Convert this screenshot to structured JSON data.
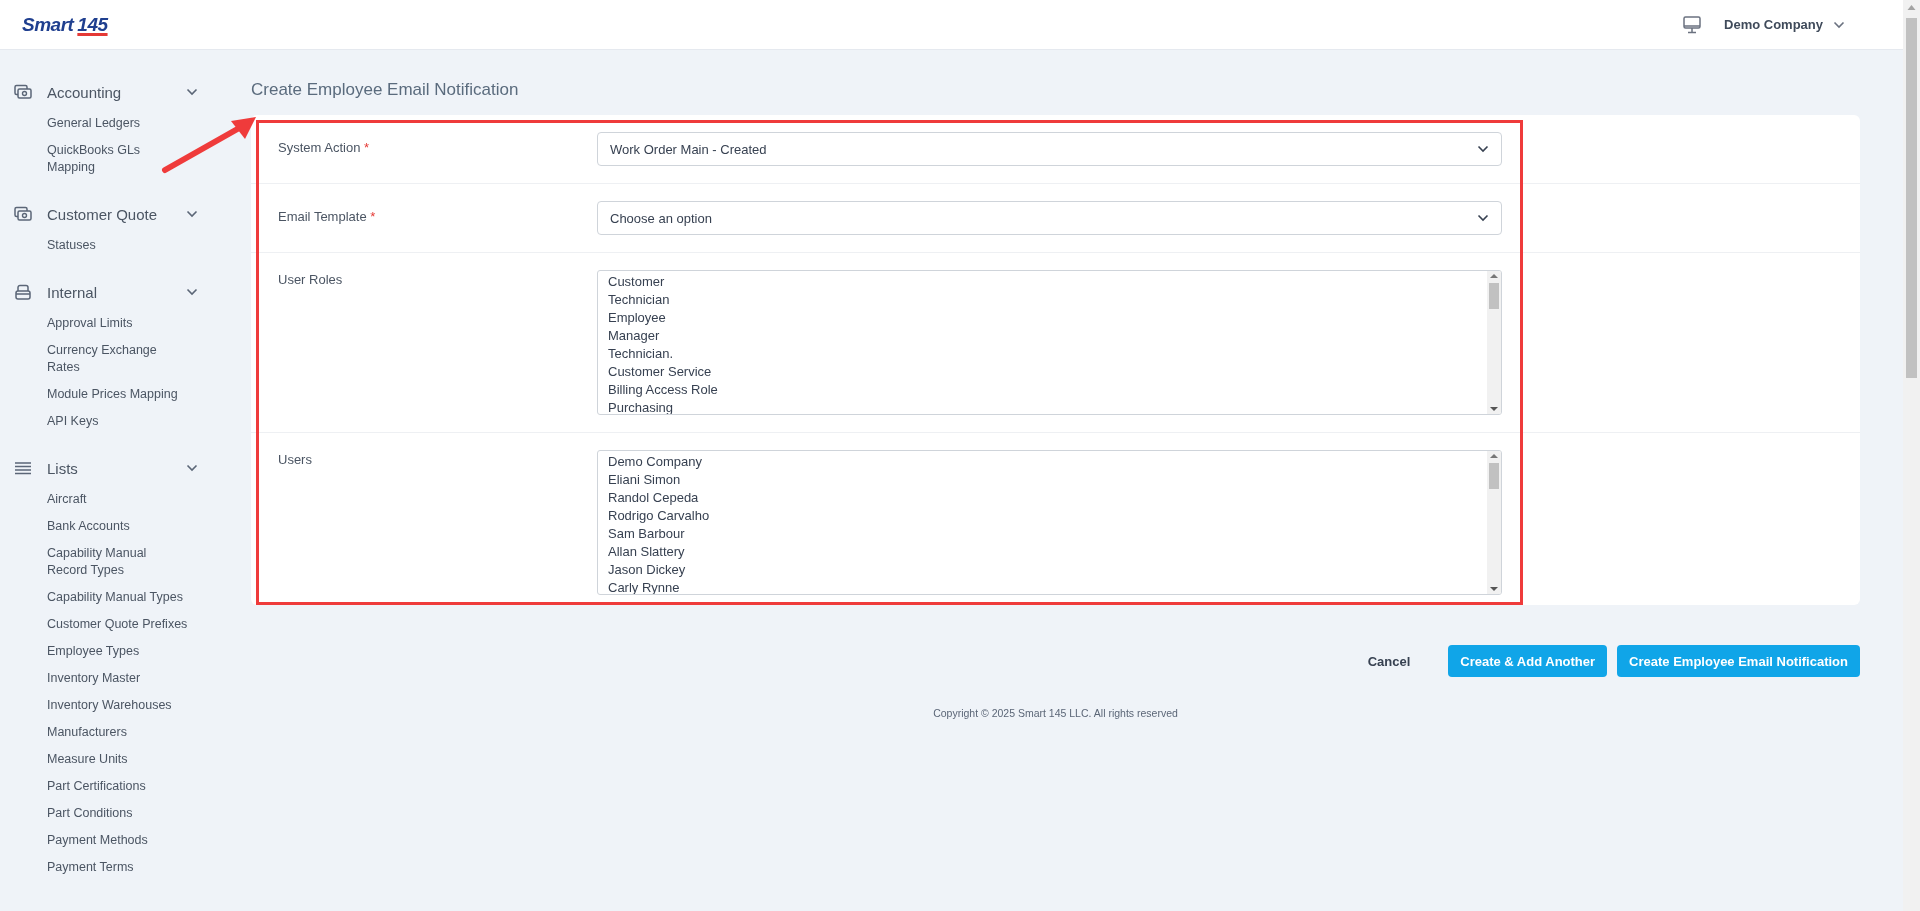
{
  "header": {
    "logo": {
      "word": "Smart",
      "number": "145"
    },
    "company": "Demo Company"
  },
  "sidebar": {
    "groups": [
      {
        "title": "Accounting",
        "expanded": true,
        "items": [
          "General Ledgers",
          "QuickBooks GLs Mapping"
        ]
      },
      {
        "title": "Customer Quote",
        "expanded": true,
        "items": [
          "Statuses"
        ]
      },
      {
        "title": "Internal",
        "expanded": true,
        "items": [
          "Approval Limits",
          "Currency Exchange Rates",
          "Module Prices Mapping",
          "API Keys"
        ]
      },
      {
        "title": "Lists",
        "expanded": true,
        "items": [
          "Aircraft",
          "Bank Accounts",
          "Capability Manual Record Types",
          "Capability Manual Types",
          "Customer Quote Prefixes",
          "Employee Types",
          "Inventory Master",
          "Inventory Warehouses",
          "Manufacturers",
          "Measure Units",
          "Part Certifications",
          "Part Conditions",
          "Payment Methods",
          "Payment Terms"
        ]
      }
    ]
  },
  "page_title": "Create Employee Email Notification",
  "form": {
    "fields": [
      {
        "kind": "select",
        "label": "System Action",
        "required_mark": "*",
        "value": "Work Order Main - Created"
      },
      {
        "kind": "select",
        "label": "Email Template",
        "required_mark": "*",
        "placeholder": "Choose an option"
      },
      {
        "kind": "multiselect",
        "label": "User Roles",
        "options": [
          "Customer",
          "Technician",
          "Employee",
          "Manager",
          "Technician.",
          "Customer Service",
          "Billing Access Role",
          "Purchasing"
        ]
      },
      {
        "kind": "multiselect",
        "label": "Users",
        "options": [
          "Demo Company",
          "Eliani Simon",
          "Randol Cepeda",
          "Rodrigo Carvalho",
          "Sam Barbour",
          "Allan Slattery",
          "Jason Dickey",
          "Carly Rynne"
        ]
      }
    ]
  },
  "actions": [
    {
      "kind": "link",
      "label": "Cancel"
    },
    {
      "kind": "primary",
      "label": "Create & Add Another"
    },
    {
      "kind": "primary",
      "label": "Create Employee Email Notification"
    }
  ],
  "footer": "Copyright © 2025 Smart 145 LLC. All rights reserved"
}
